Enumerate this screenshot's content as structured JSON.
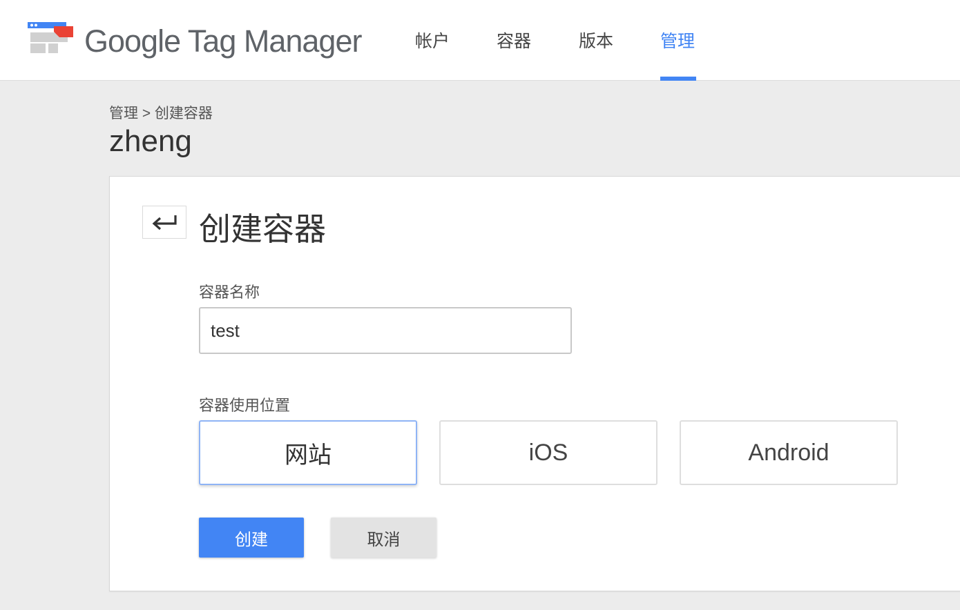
{
  "app": {
    "logo_text": "Google Tag Manager"
  },
  "nav": {
    "items": [
      {
        "label": "帐户",
        "active": false
      },
      {
        "label": "容器",
        "active": false
      },
      {
        "label": "版本",
        "active": false
      },
      {
        "label": "管理",
        "active": true
      }
    ]
  },
  "breadcrumb": {
    "text": "管理 > 创建容器"
  },
  "account": {
    "name": "zheng"
  },
  "form": {
    "title": "创建容器",
    "back_icon": "return-arrow-icon",
    "name_label": "容器名称",
    "name_value": "test",
    "usage_label": "容器使用位置",
    "platforms": [
      {
        "label": "网站",
        "selected": true
      },
      {
        "label": "iOS",
        "selected": false
      },
      {
        "label": "Android",
        "selected": false
      }
    ],
    "create_label": "创建",
    "cancel_label": "取消"
  },
  "colors": {
    "accent": "#4285f4",
    "background": "#ececec",
    "logo_red": "#ea4335",
    "logo_gray": "#d0d0d0"
  }
}
